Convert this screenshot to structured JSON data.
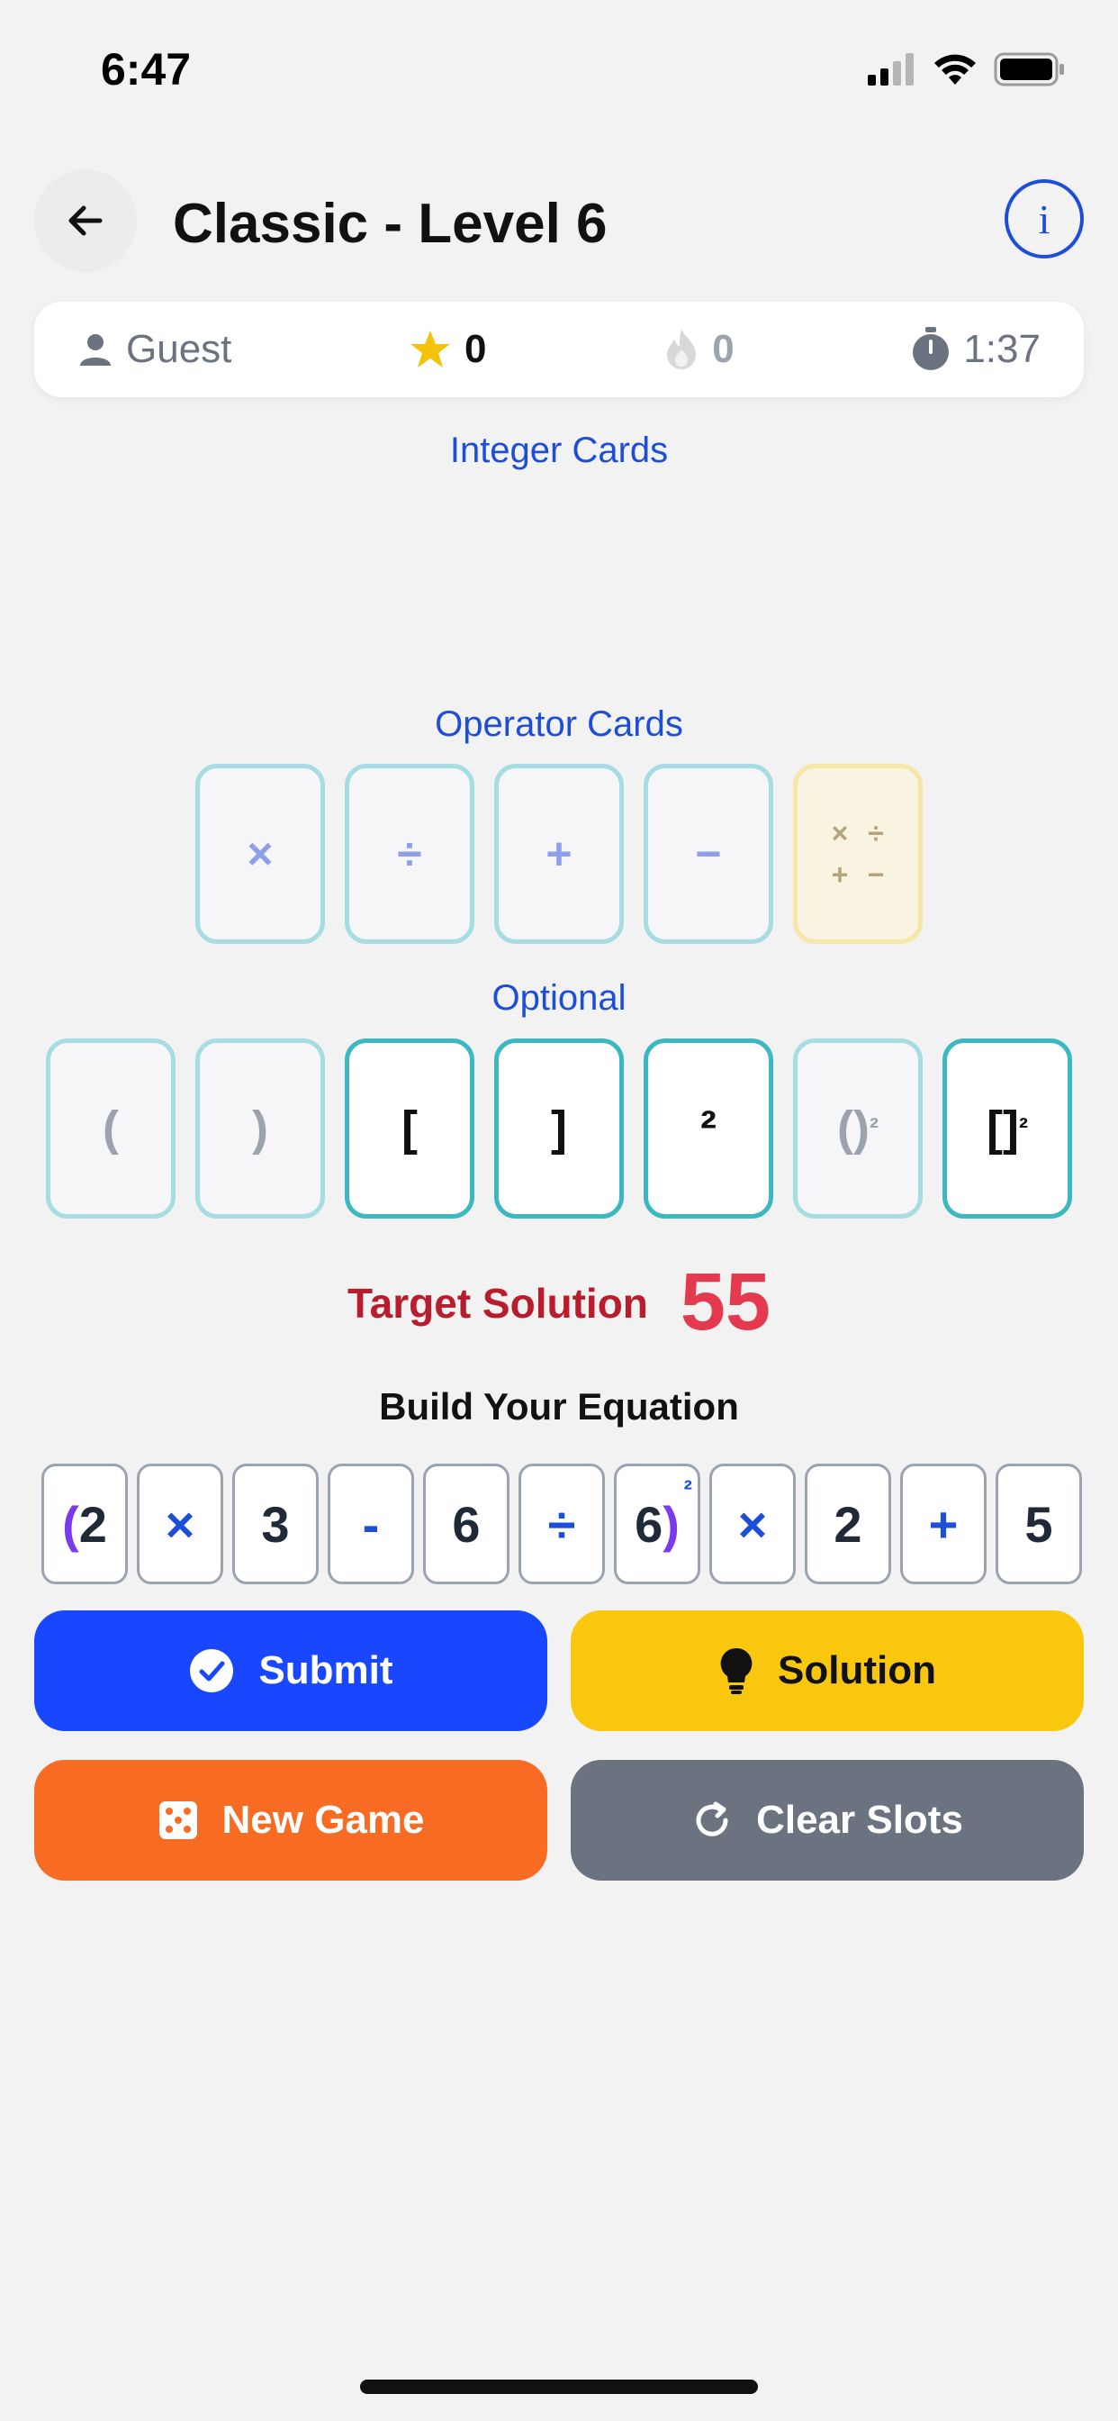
{
  "status_bar": {
    "time": "6:47"
  },
  "header": {
    "title": "Classic - Level 6",
    "info_label": "i"
  },
  "stats": {
    "user": "Guest",
    "stars": "0",
    "streak": "0",
    "timer": "1:37"
  },
  "sections": {
    "integer_cards": "Integer Cards",
    "operator_cards": "Operator Cards",
    "optional": "Optional"
  },
  "operator_cards": [
    "×",
    "÷",
    "+",
    "−"
  ],
  "combo_card": [
    "×",
    "÷",
    "+",
    "−"
  ],
  "optional_cards": [
    "(",
    ")",
    "[",
    "]",
    "²",
    "()",
    "[]"
  ],
  "optional_sup": "²",
  "target": {
    "label": "Target Solution",
    "value": "55"
  },
  "build_label": "Build Your Equation",
  "equation": {
    "s0_paren": "(",
    "s0_val": "2",
    "s1": "×",
    "s2": "3",
    "s3": "-",
    "s4": "6",
    "s5": "÷",
    "s6_val": "6",
    "s6_paren": ")",
    "s6_sq": "²",
    "s7": "×",
    "s8": "2",
    "s9": "+",
    "s10": "5"
  },
  "buttons": {
    "submit": "Submit",
    "solution": "Solution",
    "new_game": "New Game",
    "clear_slots": "Clear Slots"
  },
  "colors": {
    "primary": "#1947ff",
    "solution": "#f9c80e",
    "new_game": "#f76b22",
    "clear": "#6b7280",
    "target": "#e53950",
    "accent_blue": "#1d4ed8"
  }
}
